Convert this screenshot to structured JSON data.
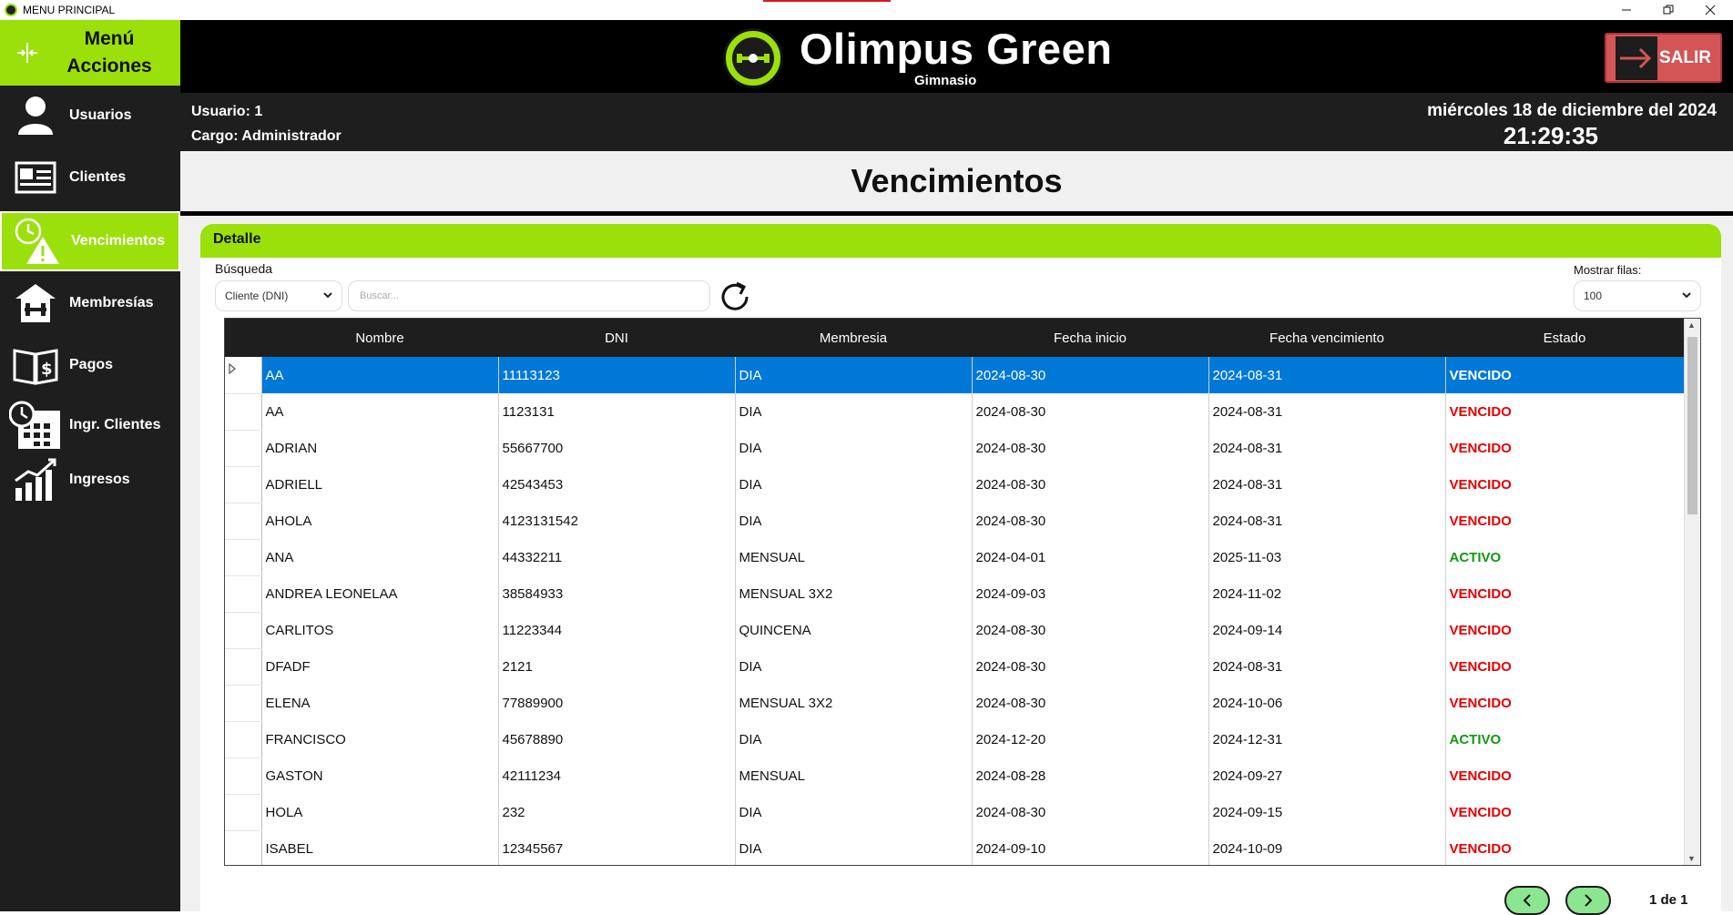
{
  "window": {
    "title": "MENU PRINCIPAL",
    "controls": [
      "minimize-icon",
      "restore-icon",
      "close-icon"
    ]
  },
  "sidebar": {
    "header": {
      "line1": "Menú",
      "line2": "Acciones"
    },
    "items": [
      {
        "label": "Usuarios",
        "icon": "user-icon",
        "active": false
      },
      {
        "label": "Clientes",
        "icon": "id-card-icon",
        "active": false
      },
      {
        "label": "Vencimientos",
        "icon": "clock-warning-icon",
        "active": true
      },
      {
        "label": "Membresías",
        "icon": "gym-icon",
        "active": false
      },
      {
        "label": "Pagos",
        "icon": "payment-book-icon",
        "active": false
      },
      {
        "label": "Ingr. Clientes",
        "icon": "calendar-clock-icon",
        "active": false
      },
      {
        "label": "Ingresos",
        "icon": "chart-icon",
        "active": false
      }
    ]
  },
  "header": {
    "brand": "Olimpus Green",
    "subtitle": "Gimnasio",
    "exit_label": "SALIR"
  },
  "info": {
    "user": "Usuario: 1",
    "role": "Cargo: Administrador",
    "date": "miércoles 18 de diciembre del 2024",
    "time": "21:29:35"
  },
  "page": {
    "title": "Vencimientos"
  },
  "panel": {
    "title": "Detalle",
    "search_label": "Búsqueda",
    "filter_value": "Cliente (DNI)",
    "search_placeholder": "Buscar...",
    "rows_label": "Mostrar filas:",
    "rows_value": "100"
  },
  "table": {
    "columns": [
      "Nombre",
      "DNI",
      "Membresia",
      "Fecha inicio",
      "Fecha vencimiento",
      "Estado"
    ],
    "rows": [
      [
        "AA",
        "11113123",
        "DIA",
        "2024-08-30",
        "2024-08-31",
        "VENCIDO"
      ],
      [
        "AA",
        "1123131",
        "DIA",
        "2024-08-30",
        "2024-08-31",
        "VENCIDO"
      ],
      [
        "ADRIAN",
        "55667700",
        "DIA",
        "2024-08-30",
        "2024-08-31",
        "VENCIDO"
      ],
      [
        "ADRIELL",
        "42543453",
        "DIA",
        "2024-08-30",
        "2024-08-31",
        "VENCIDO"
      ],
      [
        "AHOLA",
        "4123131542",
        "DIA",
        "2024-08-30",
        "2024-08-31",
        "VENCIDO"
      ],
      [
        "ANA",
        "44332211",
        "MENSUAL",
        "2024-04-01",
        "2025-11-03",
        "ACTIVO"
      ],
      [
        "ANDREA LEONELAA",
        "38584933",
        "MENSUAL 3X2",
        "2024-09-03",
        "2024-11-02",
        "VENCIDO"
      ],
      [
        "CARLITOS",
        "11223344",
        "QUINCENA",
        "2024-08-30",
        "2024-09-14",
        "VENCIDO"
      ],
      [
        "DFADF",
        "2121",
        "DIA",
        "2024-08-30",
        "2024-08-31",
        "VENCIDO"
      ],
      [
        "ELENA",
        "77889900",
        "MENSUAL 3X2",
        "2024-08-30",
        "2024-10-06",
        "VENCIDO"
      ],
      [
        "FRANCISCO",
        "45678890",
        "DIA",
        "2024-12-20",
        "2024-12-31",
        "ACTIVO"
      ],
      [
        "GASTON",
        "42111234",
        "MENSUAL",
        "2024-08-28",
        "2024-09-27",
        "VENCIDO"
      ],
      [
        "HOLA",
        "232",
        "DIA",
        "2024-08-30",
        "2024-09-15",
        "VENCIDO"
      ],
      [
        "ISABEL",
        "12345567",
        "DIA",
        "2024-09-10",
        "2024-10-09",
        "VENCIDO"
      ]
    ],
    "selected_index": 0
  },
  "pager": {
    "text": "1 de 1"
  },
  "colors": {
    "accent": "#9be00b",
    "selected": "#0078d7",
    "vencido": "#e60000",
    "activo": "#11990f"
  }
}
